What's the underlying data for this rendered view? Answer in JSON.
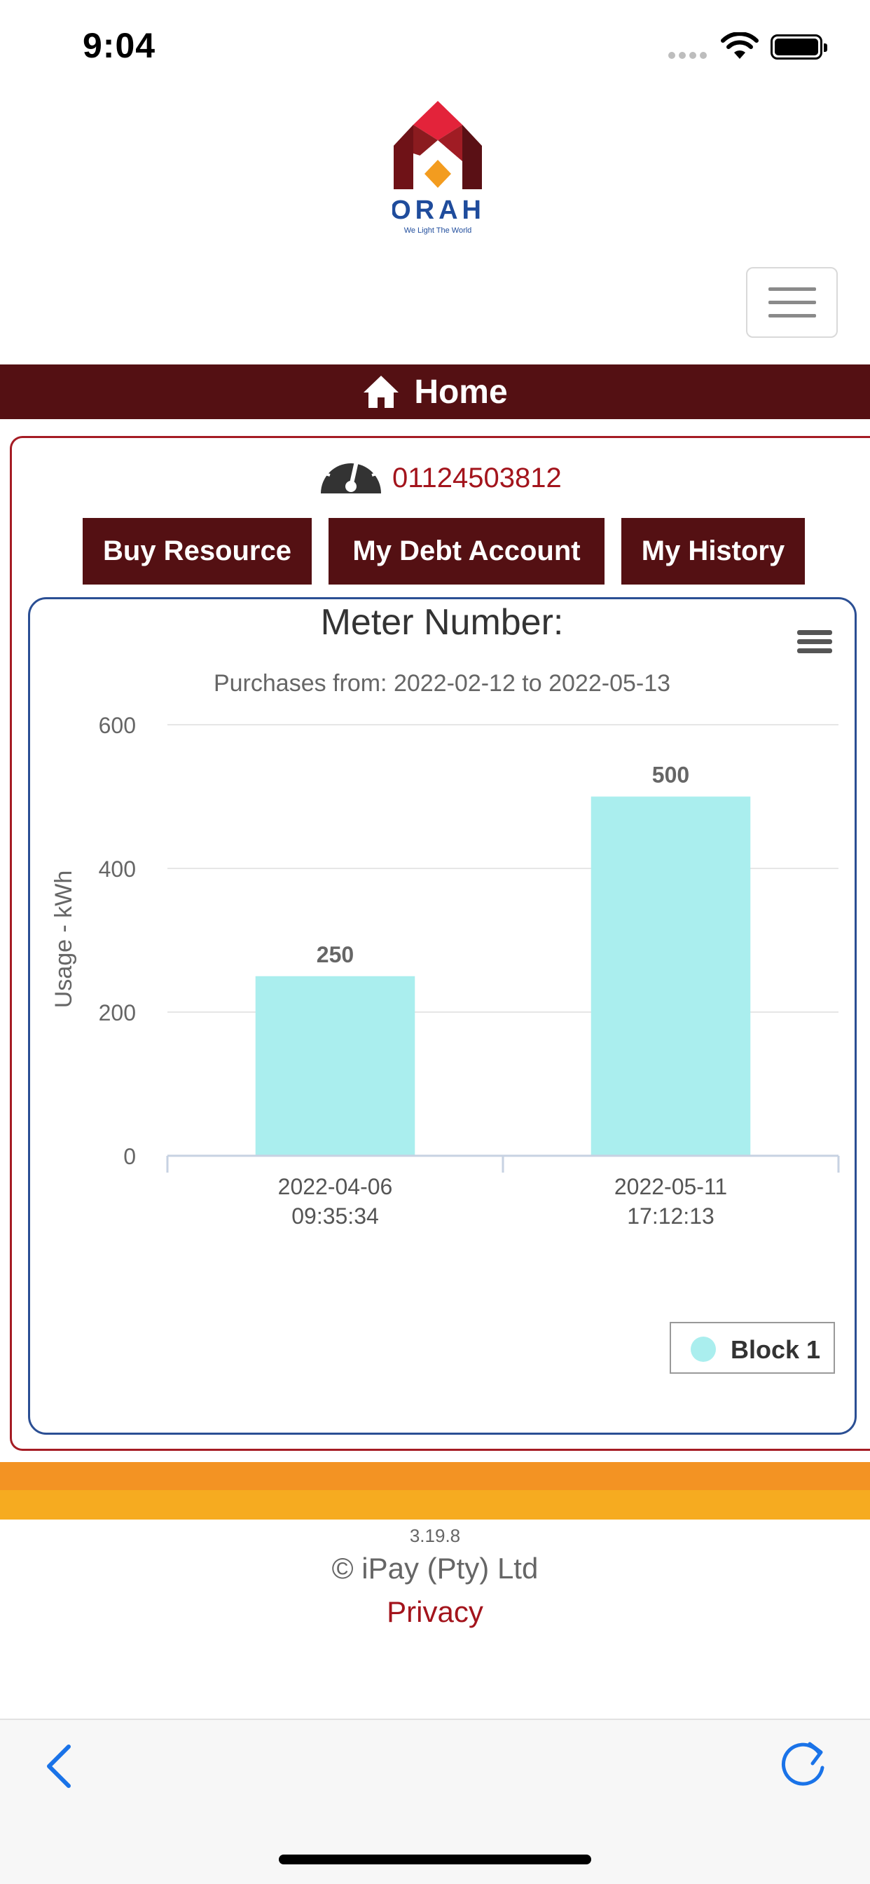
{
  "status_bar": {
    "time": "9:04"
  },
  "header": {
    "home_label": "Home"
  },
  "logo": {
    "text": "ORAH",
    "tagline": "We Light The World"
  },
  "meter": {
    "number": "01124503812"
  },
  "actions": {
    "buy_label": "Buy Resource",
    "debt_label": "My Debt Account",
    "history_label": "My History"
  },
  "chart_data": {
    "type": "bar",
    "title": "Meter Number:",
    "subtitle": "Purchases from: 2022-02-12 to 2022-05-13",
    "xlabel": "",
    "ylabel": "Usage - kWh",
    "categories": [
      "2022-04-06 09:35:34",
      "2022-05-11 17:12:13"
    ],
    "category_lines": [
      [
        "2022-04-06",
        "09:35:34"
      ],
      [
        "2022-05-11",
        "17:12:13"
      ]
    ],
    "series": [
      {
        "name": "Block 1",
        "values": [
          250,
          500
        ],
        "color": "#aaeeee"
      }
    ],
    "ylim": [
      0,
      600
    ],
    "yticks": [
      0,
      200,
      400,
      600
    ],
    "grid": true,
    "legend": "bottom-right",
    "data_labels": true
  },
  "footer": {
    "version": "3.19.8",
    "copyright": "© iPay (Pty) Ltd",
    "privacy": "Privacy"
  },
  "colors": {
    "brand": "#541013",
    "accent": "#a3141c",
    "chart_border": "#2b4f94",
    "stripe_orange": "#f39323",
    "stripe_yellow": "#f6ab20"
  },
  "icons": {
    "home": "home-icon",
    "meter": "speedometer-icon",
    "chart_menu": "hamburger-icon",
    "back": "chevron-left-icon",
    "reload": "reload-icon"
  }
}
